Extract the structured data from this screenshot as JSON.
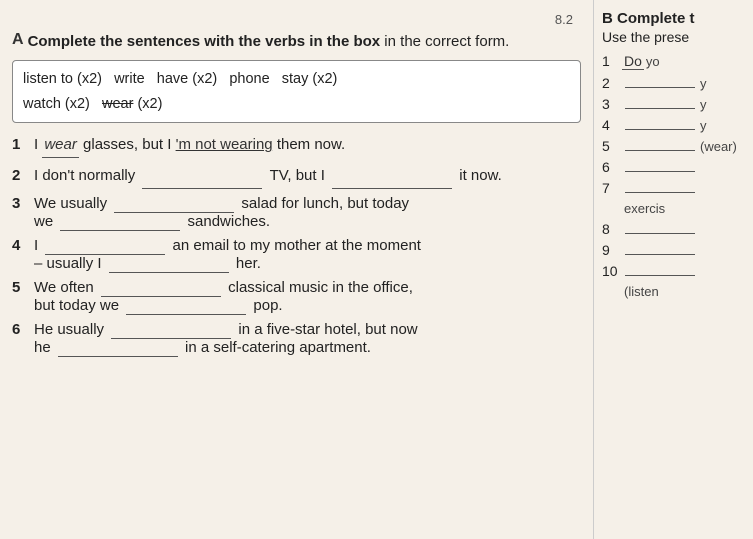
{
  "section_a": {
    "label": "A",
    "instructions": "Complete the sentences with the verbs in the box in the correct form.",
    "verb_box": {
      "line1": [
        "listen to (x2)",
        "write",
        "have (x2)",
        "phone",
        "stay (x2)"
      ],
      "line2": [
        "watch (x2)",
        "wear (x2)"
      ]
    },
    "items": [
      {
        "num": "1",
        "prefix": "I",
        "filled1": "wear",
        "mid1": "glasses, but I",
        "filled2": "'m not wearing",
        "suffix": "them now.",
        "has_indent": false
      },
      {
        "num": "2",
        "prefix": "I don't normally",
        "blank1": true,
        "mid1": "TV, but I",
        "blank2": true,
        "suffix": "it now.",
        "has_indent": false
      },
      {
        "num": "3",
        "prefix": "We usually",
        "blank1": true,
        "mid1": "salad for lunch, but today we",
        "blank2": true,
        "suffix": "sandwiches.",
        "has_indent": false
      },
      {
        "num": "4",
        "prefix": "I",
        "blank1": true,
        "mid1": "an email to my mother at the moment – usually I",
        "blank2": true,
        "suffix": "her.",
        "has_indent": false
      },
      {
        "num": "5",
        "prefix": "We often",
        "blank1": true,
        "mid1": "classical music in the office, but today we",
        "blank2": true,
        "suffix": "pop.",
        "has_indent": false
      },
      {
        "num": "6",
        "prefix": "He usually",
        "blank1": true,
        "mid1": "in a five-star hotel, but now he",
        "blank2": true,
        "suffix": "in a self-catering apartment.",
        "has_indent": false
      }
    ]
  },
  "section_b": {
    "label": "B",
    "header": "Complete t",
    "sub": "Use the prese",
    "items": [
      {
        "num": "1",
        "filled": "Do",
        "hint": "yo"
      },
      {
        "num": "2",
        "filled": "",
        "hint": "y"
      },
      {
        "num": "3",
        "filled": "",
        "hint": "y"
      },
      {
        "num": "4",
        "filled": "",
        "hint": "y"
      },
      {
        "num": "5",
        "hint": "(wear)"
      },
      {
        "num": "6",
        "filled": ""
      },
      {
        "num": "7",
        "filled": ""
      },
      {
        "num": "",
        "hint": "exercis"
      },
      {
        "num": "8",
        "filled": ""
      },
      {
        "num": "9",
        "filled": ""
      },
      {
        "num": "10",
        "filled": ""
      },
      {
        "num": "",
        "hint": "(listen"
      }
    ]
  },
  "section_num": "8.2"
}
